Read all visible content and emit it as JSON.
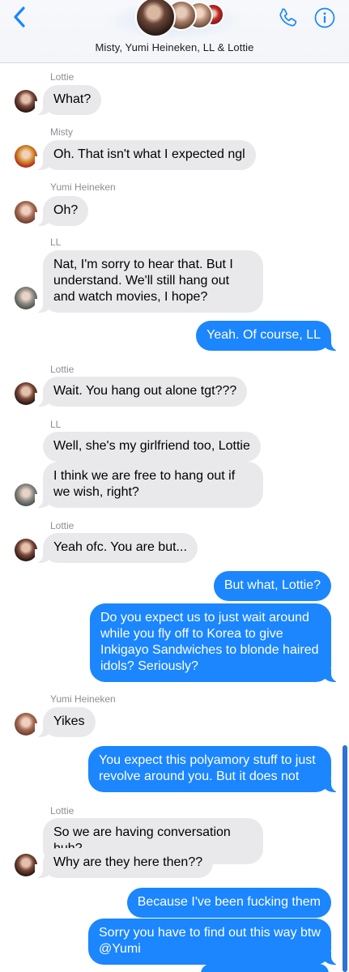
{
  "header": {
    "title": "Misty, Yumi Heineken, LL & Lottie",
    "colors": {
      "accent": "#1b86fe"
    }
  },
  "icons": [
    "chevron-left-icon",
    "phone-icon",
    "info-icon"
  ],
  "messages": [
    {
      "sender": "Lottie",
      "text": "What?"
    },
    {
      "sender": "Misty",
      "text": "Oh. That isn't what I expected ngl"
    },
    {
      "sender": "Yumi Heineken",
      "text": "Oh?"
    },
    {
      "sender": "LL",
      "text": "Nat, I'm sorry to hear that. But I understand. We'll still hang out and watch movies, I hope?"
    },
    {
      "sender": "me",
      "text": "Yeah. Of course, LL"
    },
    {
      "sender": "Lottie",
      "text": "Wait. You hang out alone tgt???"
    },
    {
      "sender": "LL",
      "text": "Well, she's my girlfriend too, Lottie"
    },
    {
      "sender": "LL",
      "text": "I think we are free to hang out if we wish, right?"
    },
    {
      "sender": "Lottie",
      "text": "Yeah ofc. You are but..."
    },
    {
      "sender": "me",
      "text": "But what, Lottie?"
    },
    {
      "sender": "me",
      "text": "Do you expect us to just wait around while you fly off to Korea to give Inkigayo Sandwiches to blonde haired idols? Seriously?"
    },
    {
      "sender": "Yumi Heineken",
      "text": "Yikes"
    },
    {
      "sender": "me",
      "text": "You expect this polyamory stuff to just revolve around you. But it does not"
    },
    {
      "sender": "Lottie",
      "text": "So we are having conversation huh?"
    },
    {
      "sender": "Lottie",
      "text": "Why are they here then??"
    },
    {
      "sender": "me",
      "text": "Because I've been fucking them"
    },
    {
      "sender": "me",
      "text": "Sorry you have to find out this way btw @Yumi"
    }
  ],
  "sender_labels": {
    "lottie": "Lottie",
    "misty": "Misty",
    "yumi": "Yumi Heineken",
    "ll": "LL"
  }
}
